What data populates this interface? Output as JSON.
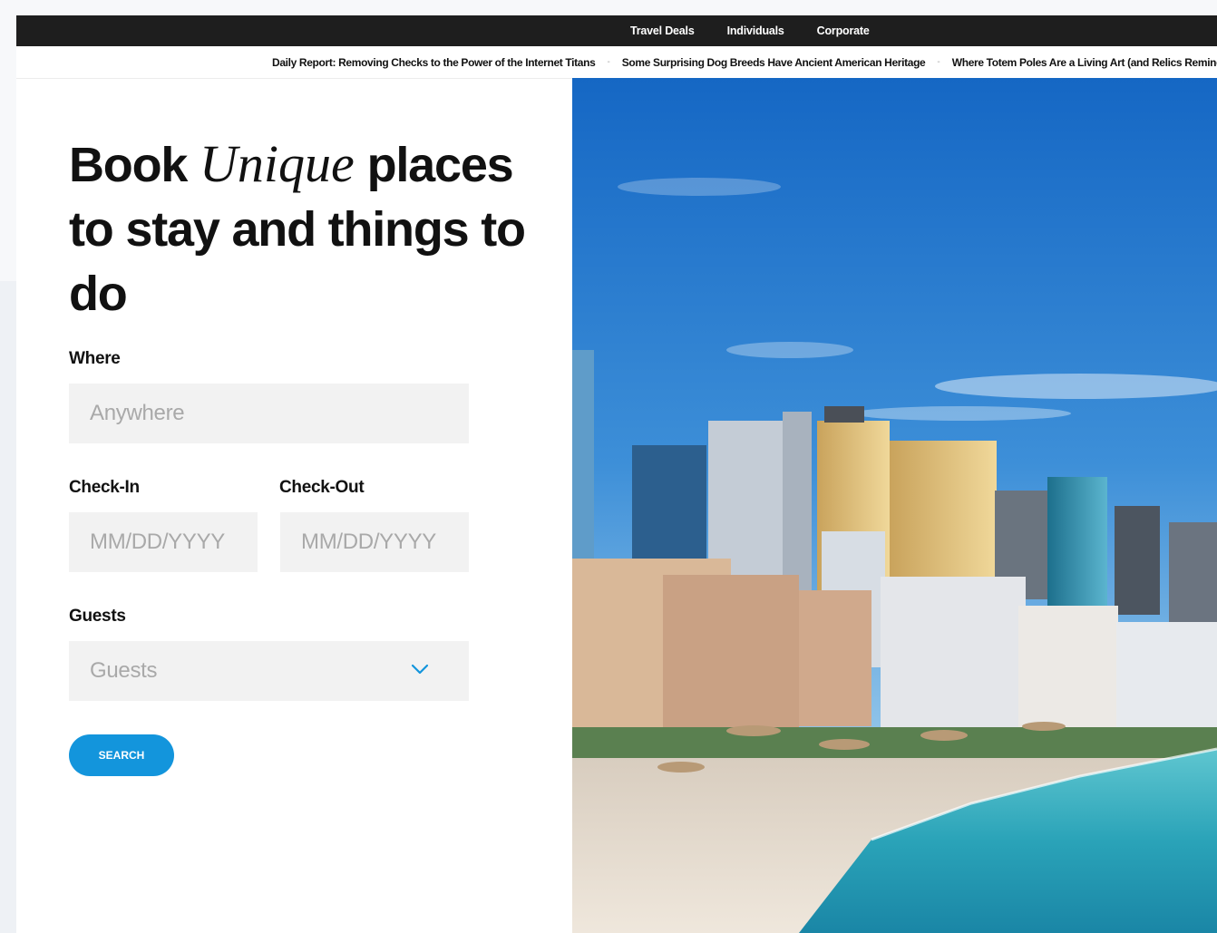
{
  "nav": {
    "items": [
      "Travel Deals",
      "Individuals",
      "Corporate"
    ]
  },
  "ticker": {
    "headlines": [
      "Daily Report: Removing Checks to the Power of the Internet Titans",
      "Some Surprising Dog Breeds Have Ancient American Heritage",
      "Where Totem Poles Are a Living Art (and Relics Reminders of the Past)"
    ],
    "separator": "-"
  },
  "hero": {
    "headline_part1": "Book ",
    "headline_emphasis": "Unique",
    "headline_part2": " places to stay and things to do"
  },
  "form": {
    "where_label": "Where",
    "where_placeholder": "Anywhere",
    "checkin_label": "Check-In",
    "checkin_placeholder": "MM/DD/YYYY",
    "checkout_label": "Check-Out",
    "checkout_placeholder": "MM/DD/YYYY",
    "guests_label": "Guests",
    "guests_value": "Guests",
    "search_label": "SEARCH"
  },
  "colors": {
    "accent": "#1395dc",
    "nav_bg": "#1e1e1e",
    "field_bg": "#f2f2f2"
  },
  "icons": {
    "guests_dropdown": "chevron-down-icon"
  },
  "image": {
    "subject": "beachfront city skyline photo"
  }
}
